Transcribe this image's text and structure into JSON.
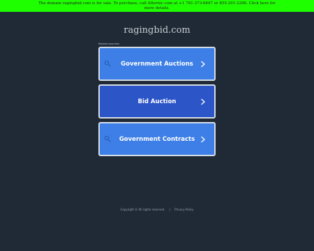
{
  "banner": {
    "line1": "The domain ragingbid.com is for sale. To purchase, call Afternic.com at +1 781-373-6847 or 855-201-2286. Click here for",
    "line2": "more details."
  },
  "site_title": "ragingbid.com",
  "related_label": "Related searches",
  "links": [
    {
      "label": "Government Auctions"
    },
    {
      "label": "Bid Auction"
    },
    {
      "label": "Government Contracts"
    }
  ],
  "footer": {
    "copyright": "Copyright © All rights reserved.",
    "separator": "|",
    "privacy": "Privacy Policy"
  },
  "colors": {
    "banner_bg": "#1eff00",
    "page_bg": "#1f2a36",
    "button_bg": "#3d7fe6",
    "button_active_bg": "#2c55c7"
  }
}
